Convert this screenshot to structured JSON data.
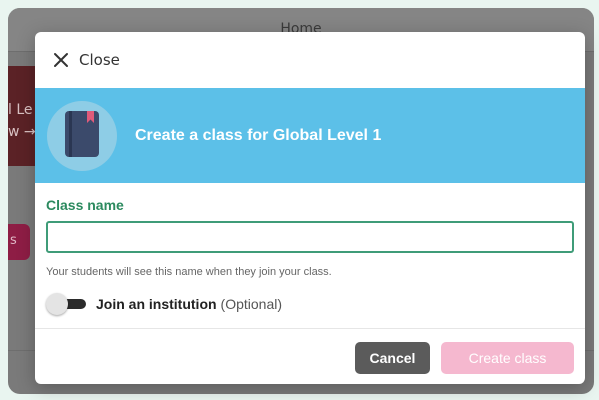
{
  "background": {
    "header_title": "Home",
    "card_line1": "l Le",
    "card_line2": "w →",
    "pill_text": "s"
  },
  "modal": {
    "close_label": "Close",
    "banner_title": "Create a class for Global Level 1",
    "class_name_label": "Class name",
    "class_name_value": "",
    "class_name_placeholder": "",
    "helper_text": "Your students will see this name when they join your class.",
    "institution_label": "Join an institution",
    "institution_optional": "(Optional)",
    "institution_toggle_on": false,
    "cancel_label": "Cancel",
    "create_label": "Create class"
  },
  "icons": {
    "close": "close-icon",
    "book": "book-icon"
  },
  "colors": {
    "banner": "#5cc0e8",
    "accent_green": "#2c8a5f",
    "create_button_disabled": "#f5b8cf",
    "cancel_button": "#5b5b5b"
  }
}
